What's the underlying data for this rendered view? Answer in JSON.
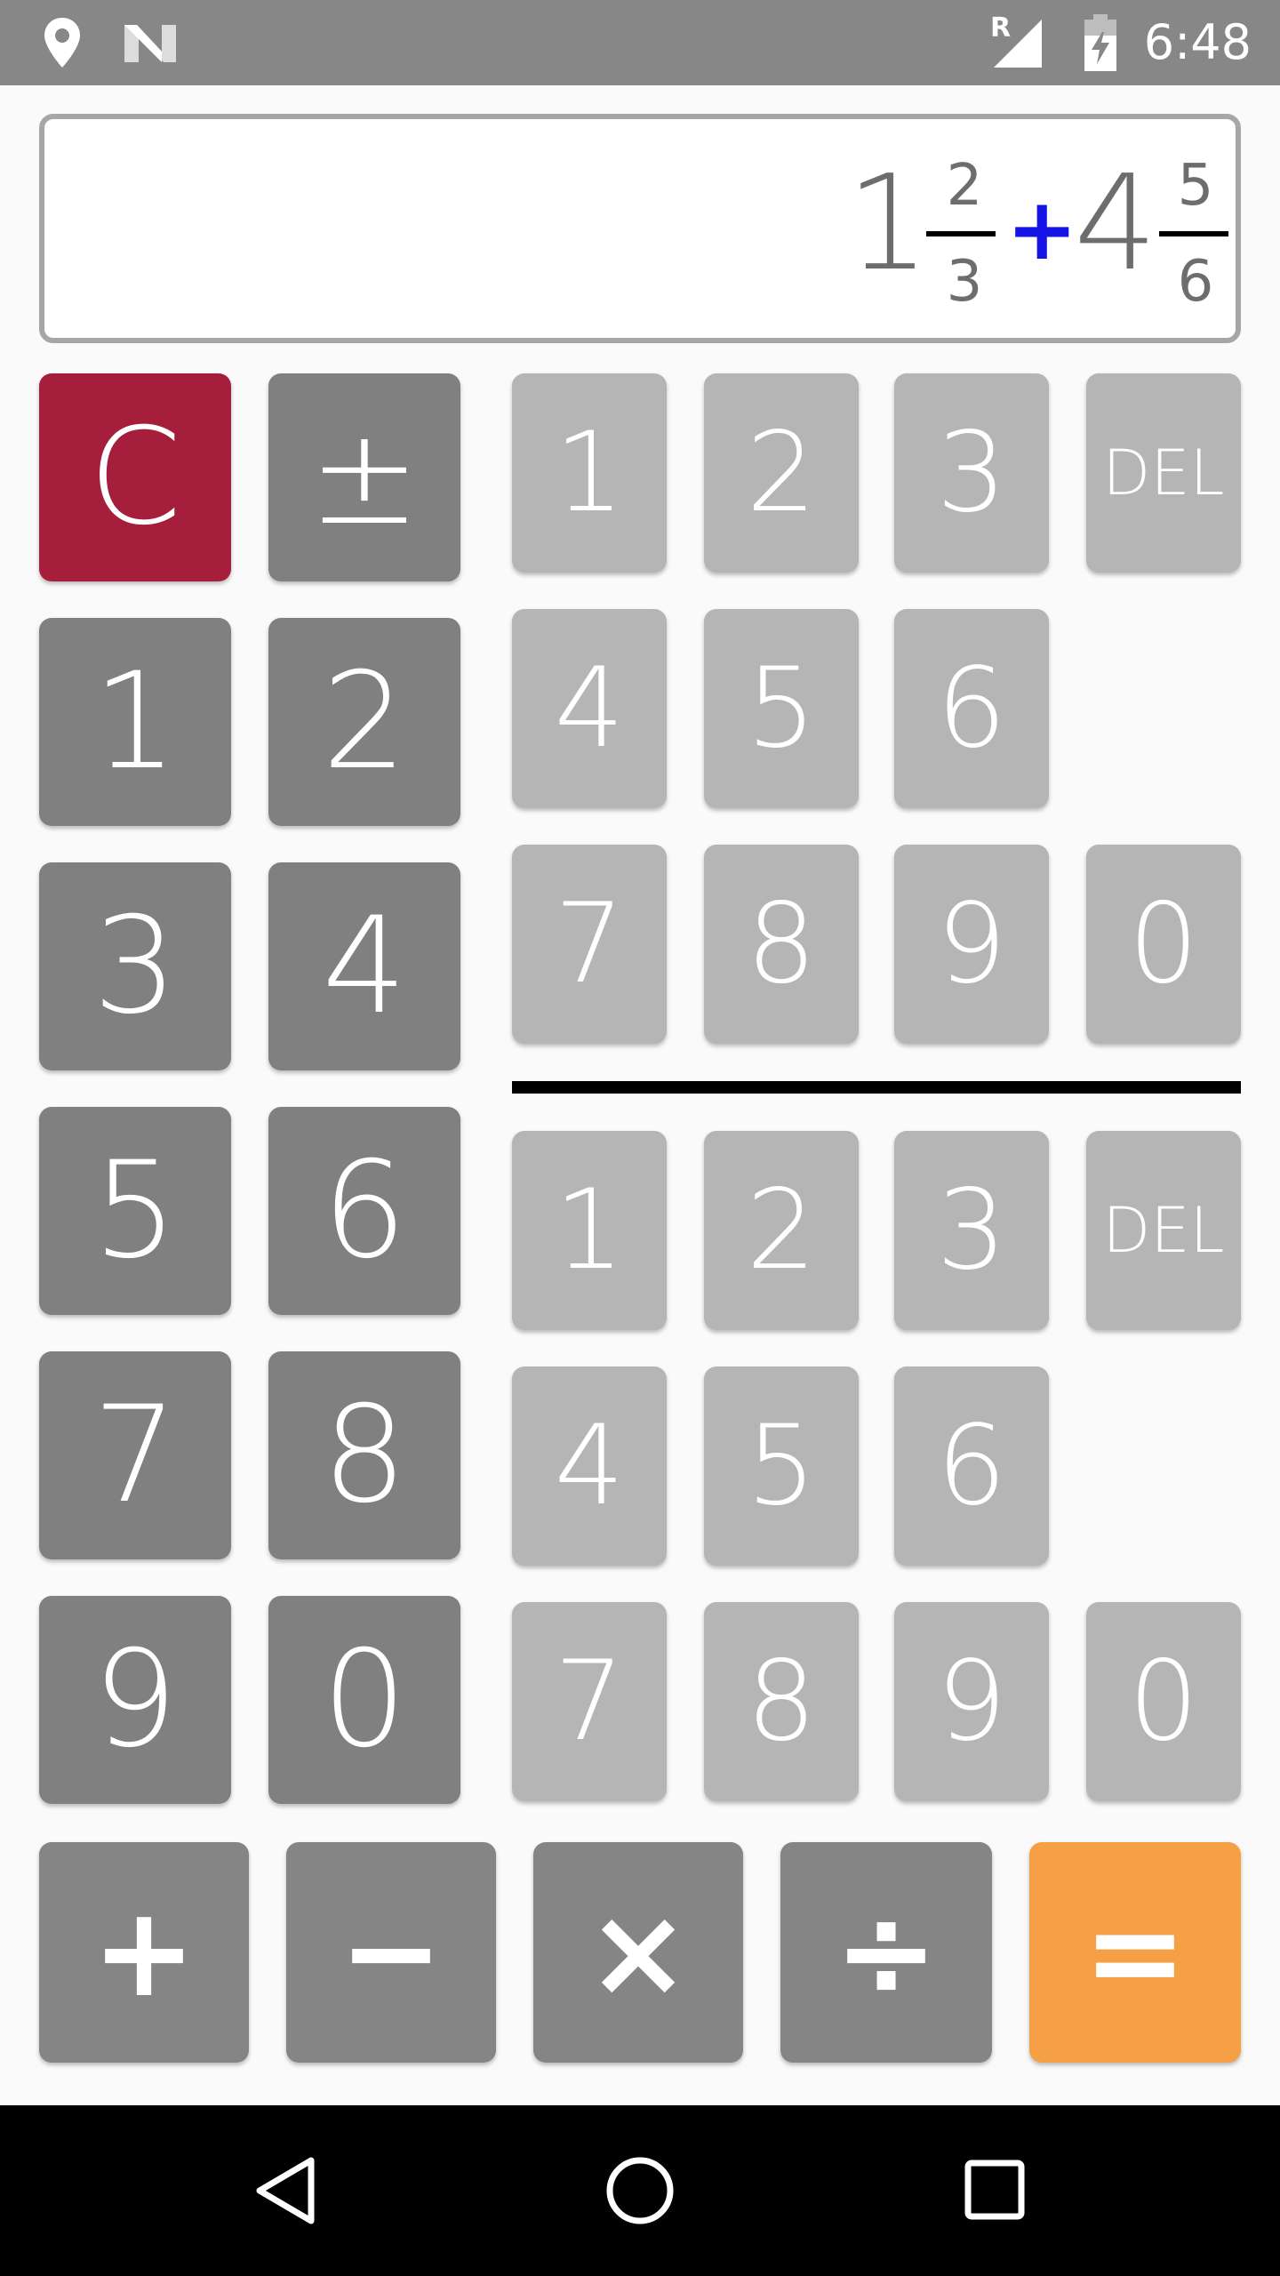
{
  "status_bar": {
    "time": "6:48",
    "icons": [
      "location-icon",
      "n-logo-icon",
      "signal-roaming-icon",
      "battery-charging-icon"
    ],
    "roaming_label": "R"
  },
  "display": {
    "operand1": {
      "whole": "1",
      "numerator": "2",
      "denominator": "3"
    },
    "operator": "+",
    "operand2": {
      "whole": "4",
      "numerator": "5",
      "denominator": "6"
    }
  },
  "whole_keys": {
    "clear": "C",
    "sign": "±",
    "digits": [
      "1",
      "2",
      "3",
      "4",
      "5",
      "6",
      "7",
      "8",
      "9",
      "0"
    ]
  },
  "numerator_keys": {
    "digits": [
      "1",
      "2",
      "3",
      "4",
      "5",
      "6",
      "7",
      "8",
      "9",
      "0"
    ],
    "delete": "DEL"
  },
  "denominator_keys": {
    "digits": [
      "1",
      "2",
      "3",
      "4",
      "5",
      "6",
      "7",
      "8",
      "9",
      "0"
    ],
    "delete": "DEL"
  },
  "operators": {
    "add": "+",
    "subtract": "−",
    "multiply": "×",
    "divide": "÷",
    "equals": "="
  },
  "colors": {
    "clear_key": "#a51e3c",
    "equals_key": "#f5a044",
    "operator_symbol": "#1414e6"
  },
  "nav_bar": {
    "icons": [
      "back-icon",
      "home-icon",
      "recents-icon"
    ]
  }
}
